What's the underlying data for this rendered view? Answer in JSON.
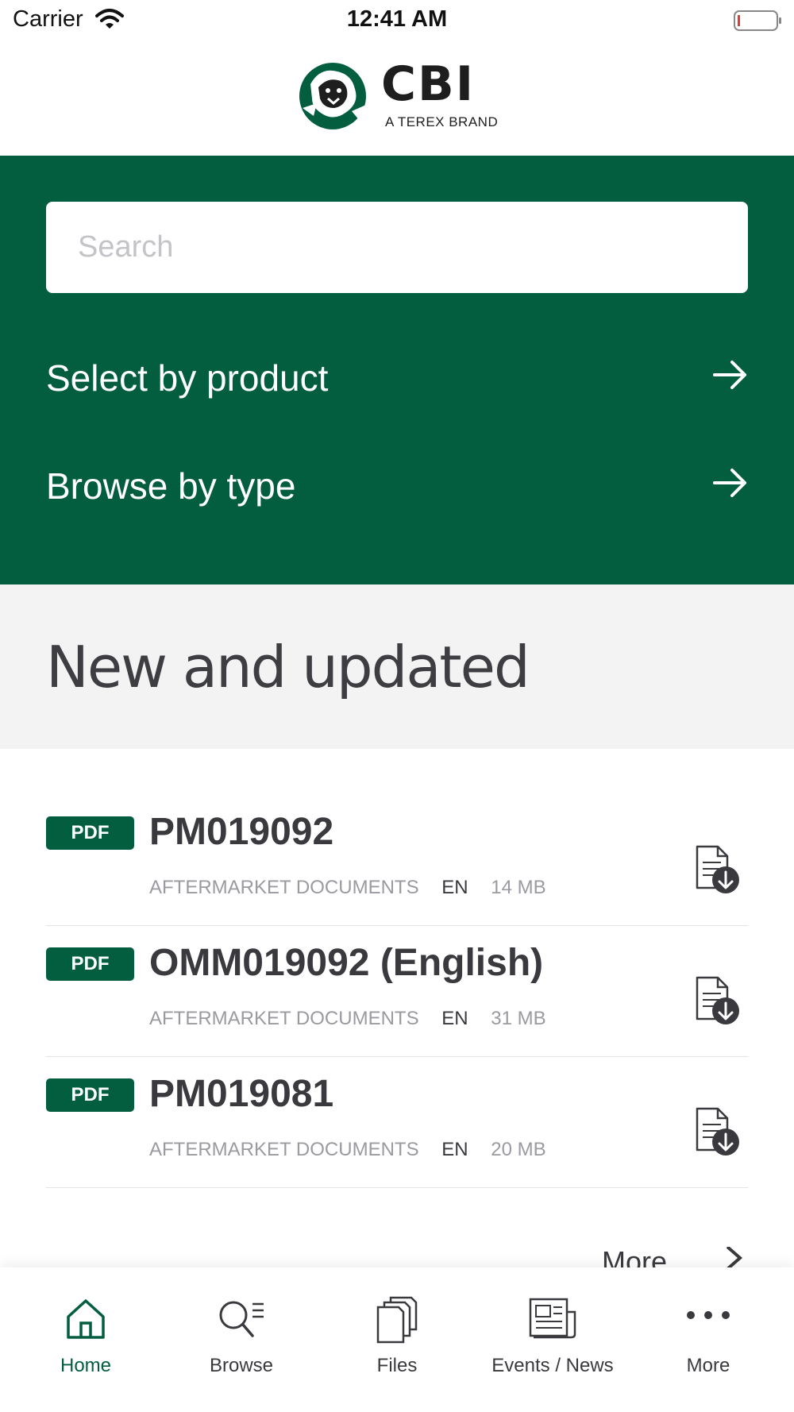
{
  "status_bar": {
    "carrier": "Carrier",
    "time": "12:41 AM"
  },
  "brand": {
    "name": "CBI",
    "tagline": "A TEREX BRAND"
  },
  "search": {
    "placeholder": "Search"
  },
  "nav_links": [
    {
      "label": "Select by product"
    },
    {
      "label": "Browse by type"
    }
  ],
  "section": {
    "title": "New and updated"
  },
  "documents": [
    {
      "type": "PDF",
      "title": "PM019092",
      "category": "AFTERMARKET DOCUMENTS",
      "language": "EN",
      "size": "14 MB"
    },
    {
      "type": "PDF",
      "title": "OMM019092 (English)",
      "category": "AFTERMARKET DOCUMENTS",
      "language": "EN",
      "size": "31 MB"
    },
    {
      "type": "PDF",
      "title": "PM019081",
      "category": "AFTERMARKET DOCUMENTS",
      "language": "EN",
      "size": "20 MB"
    }
  ],
  "more_link": {
    "label": "More"
  },
  "tabs": [
    {
      "label": "Home",
      "icon": "home-icon",
      "active": true
    },
    {
      "label": "Browse",
      "icon": "browse-icon"
    },
    {
      "label": "Files",
      "icon": "files-icon"
    },
    {
      "label": "Events / News",
      "icon": "news-icon"
    },
    {
      "label": "More",
      "icon": "more-dots-icon"
    }
  ],
  "colors": {
    "brand_green": "#035e40",
    "section_bg": "#f3f3f4",
    "battery_low": "#e53935"
  }
}
